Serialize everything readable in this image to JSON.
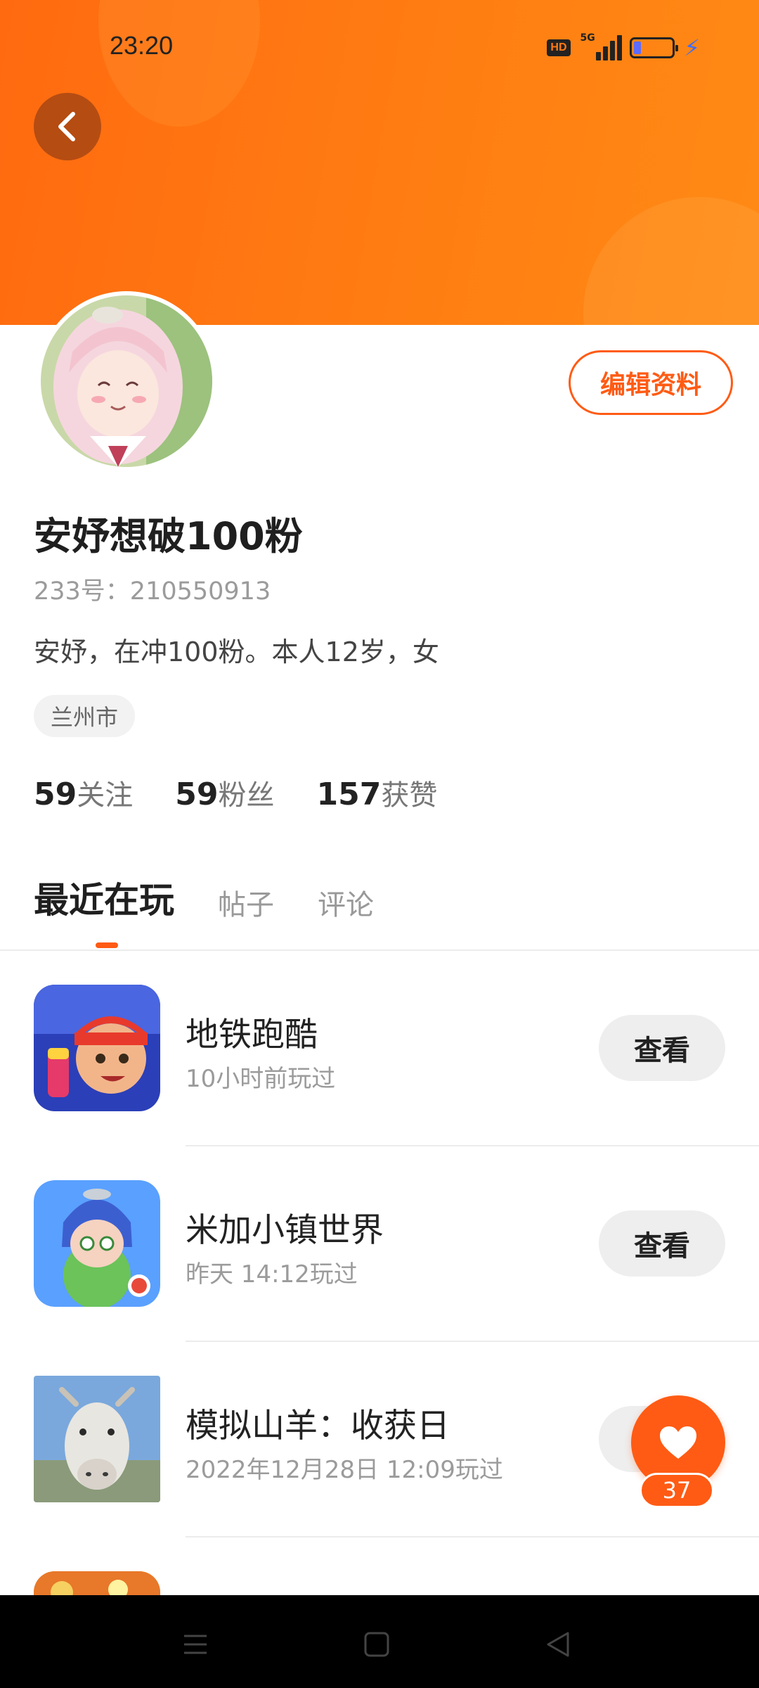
{
  "status_bar": {
    "time": "23:20",
    "hd_label": "HD",
    "network_label": "5G",
    "battery_level": 0.2
  },
  "profile": {
    "edit_label": "编辑资料",
    "username": "安妤想破100粉",
    "user_id": "233号：210550913",
    "bio": "安妤，在冲100粉。本人12岁，女",
    "location": "兰州市",
    "stats": [
      {
        "value": "59",
        "label": "关注"
      },
      {
        "value": "59",
        "label": "粉丝"
      },
      {
        "value": "157",
        "label": "获赞"
      }
    ]
  },
  "tabs": [
    {
      "label": "最近在玩",
      "active": true
    },
    {
      "label": "帖子",
      "active": false
    },
    {
      "label": "评论",
      "active": false
    }
  ],
  "games": [
    {
      "name": "地铁跑酷",
      "played": "10小时前玩过",
      "button": "查看"
    },
    {
      "name": "米加小镇世界",
      "played": "昨天 14:12玩过",
      "button": "查看"
    },
    {
      "name": "模拟山羊：收获日",
      "played": "2022年12月28日 12:09玩过",
      "button": "查看"
    }
  ],
  "like": {
    "count": "37"
  },
  "colors": {
    "accent": "#ff5b14",
    "header": "#ff7a12"
  }
}
